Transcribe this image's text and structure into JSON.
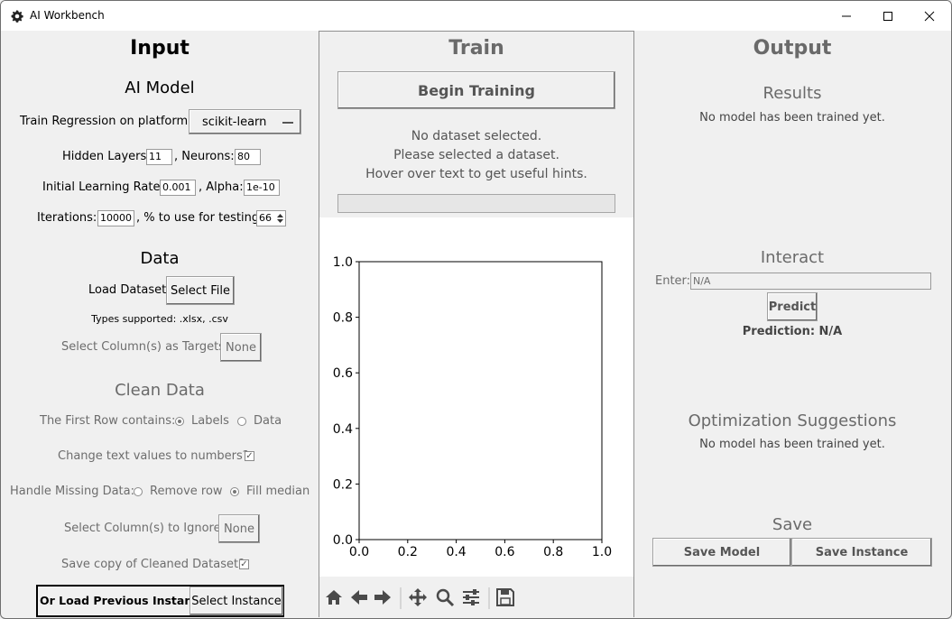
{
  "window": {
    "title": "AI Workbench",
    "icons": {
      "app": "gear-icon",
      "minimize": "minimize-icon",
      "maximize": "maximize-icon",
      "close": "close-icon"
    }
  },
  "input": {
    "heading": "Input",
    "model_heading": "AI Model",
    "platform_label": "Train Regression on platform:",
    "platform_value": "scikit-learn",
    "hidden_layers_label": "Hidden Layers:",
    "hidden_layers_value": "11",
    "neurons_label": ", Neurons:",
    "neurons_value": "80",
    "lr_label": "Initial Learning Rate:",
    "lr_value": "0.001",
    "alpha_label": ", Alpha:",
    "alpha_value": "1e-10",
    "iterations_label": "Iterations:",
    "iterations_value": "10000",
    "testing_label": ", % to use for testing:",
    "testing_value": "66",
    "data_heading": "Data",
    "load_label": "Load Dataset:",
    "select_file_label": "Select File",
    "types_supported": "Types supported: .xlsx, .csv",
    "targets_label": "Select Column(s) as Targets:",
    "targets_value": "None",
    "clean_heading": "Clean Data",
    "first_row_label": "The First Row contains:",
    "first_row_options": [
      "Labels",
      "Data"
    ],
    "first_row_selected": "Labels",
    "text_to_numbers_label": "Change text values to numbers?",
    "text_to_numbers_checked": true,
    "missing_label": "Handle Missing Data:",
    "missing_options": [
      "Remove row",
      "Fill median"
    ],
    "missing_selected": "Fill median",
    "ignore_label": "Select Column(s) to Ignore:",
    "ignore_value": "None",
    "save_clean_label": "Save copy of Cleaned Dataset?",
    "save_clean_checked": true,
    "load_instance_label": "Or Load Previous Instance:",
    "select_instance_label": "Select Instance"
  },
  "train": {
    "heading": "Train",
    "begin_label": "Begin Training",
    "status_lines": [
      "No dataset selected.",
      "Please selected a dataset.",
      "Hover over text to get useful hints."
    ],
    "progress": 0,
    "toolbar_icons": [
      "home-icon",
      "back-arrow-icon",
      "forward-arrow-icon",
      "pan-icon",
      "zoom-icon",
      "configure-subplots-icon",
      "save-figure-icon"
    ]
  },
  "output": {
    "heading": "Output",
    "results_heading": "Results",
    "results_text": "No model has been trained yet.",
    "interact_heading": "Interact",
    "enter_label": "Enter:",
    "enter_value": "N/A",
    "predict_label": "Predict",
    "prediction_text": "Prediction: N/A",
    "optimization_heading": "Optimization Suggestions",
    "optimization_text": "No model has been trained yet.",
    "save_heading": "Save",
    "save_model_label": "Save Model",
    "save_instance_label": "Save Instance"
  },
  "chart_data": {
    "type": "line",
    "series": [],
    "xlim": [
      0.0,
      1.0
    ],
    "ylim": [
      0.0,
      1.0
    ],
    "xticks": [
      "0.0",
      "0.2",
      "0.4",
      "0.6",
      "0.8",
      "1.0"
    ],
    "yticks": [
      "0.0",
      "0.2",
      "0.4",
      "0.6",
      "0.8",
      "1.0"
    ],
    "grid": false
  }
}
